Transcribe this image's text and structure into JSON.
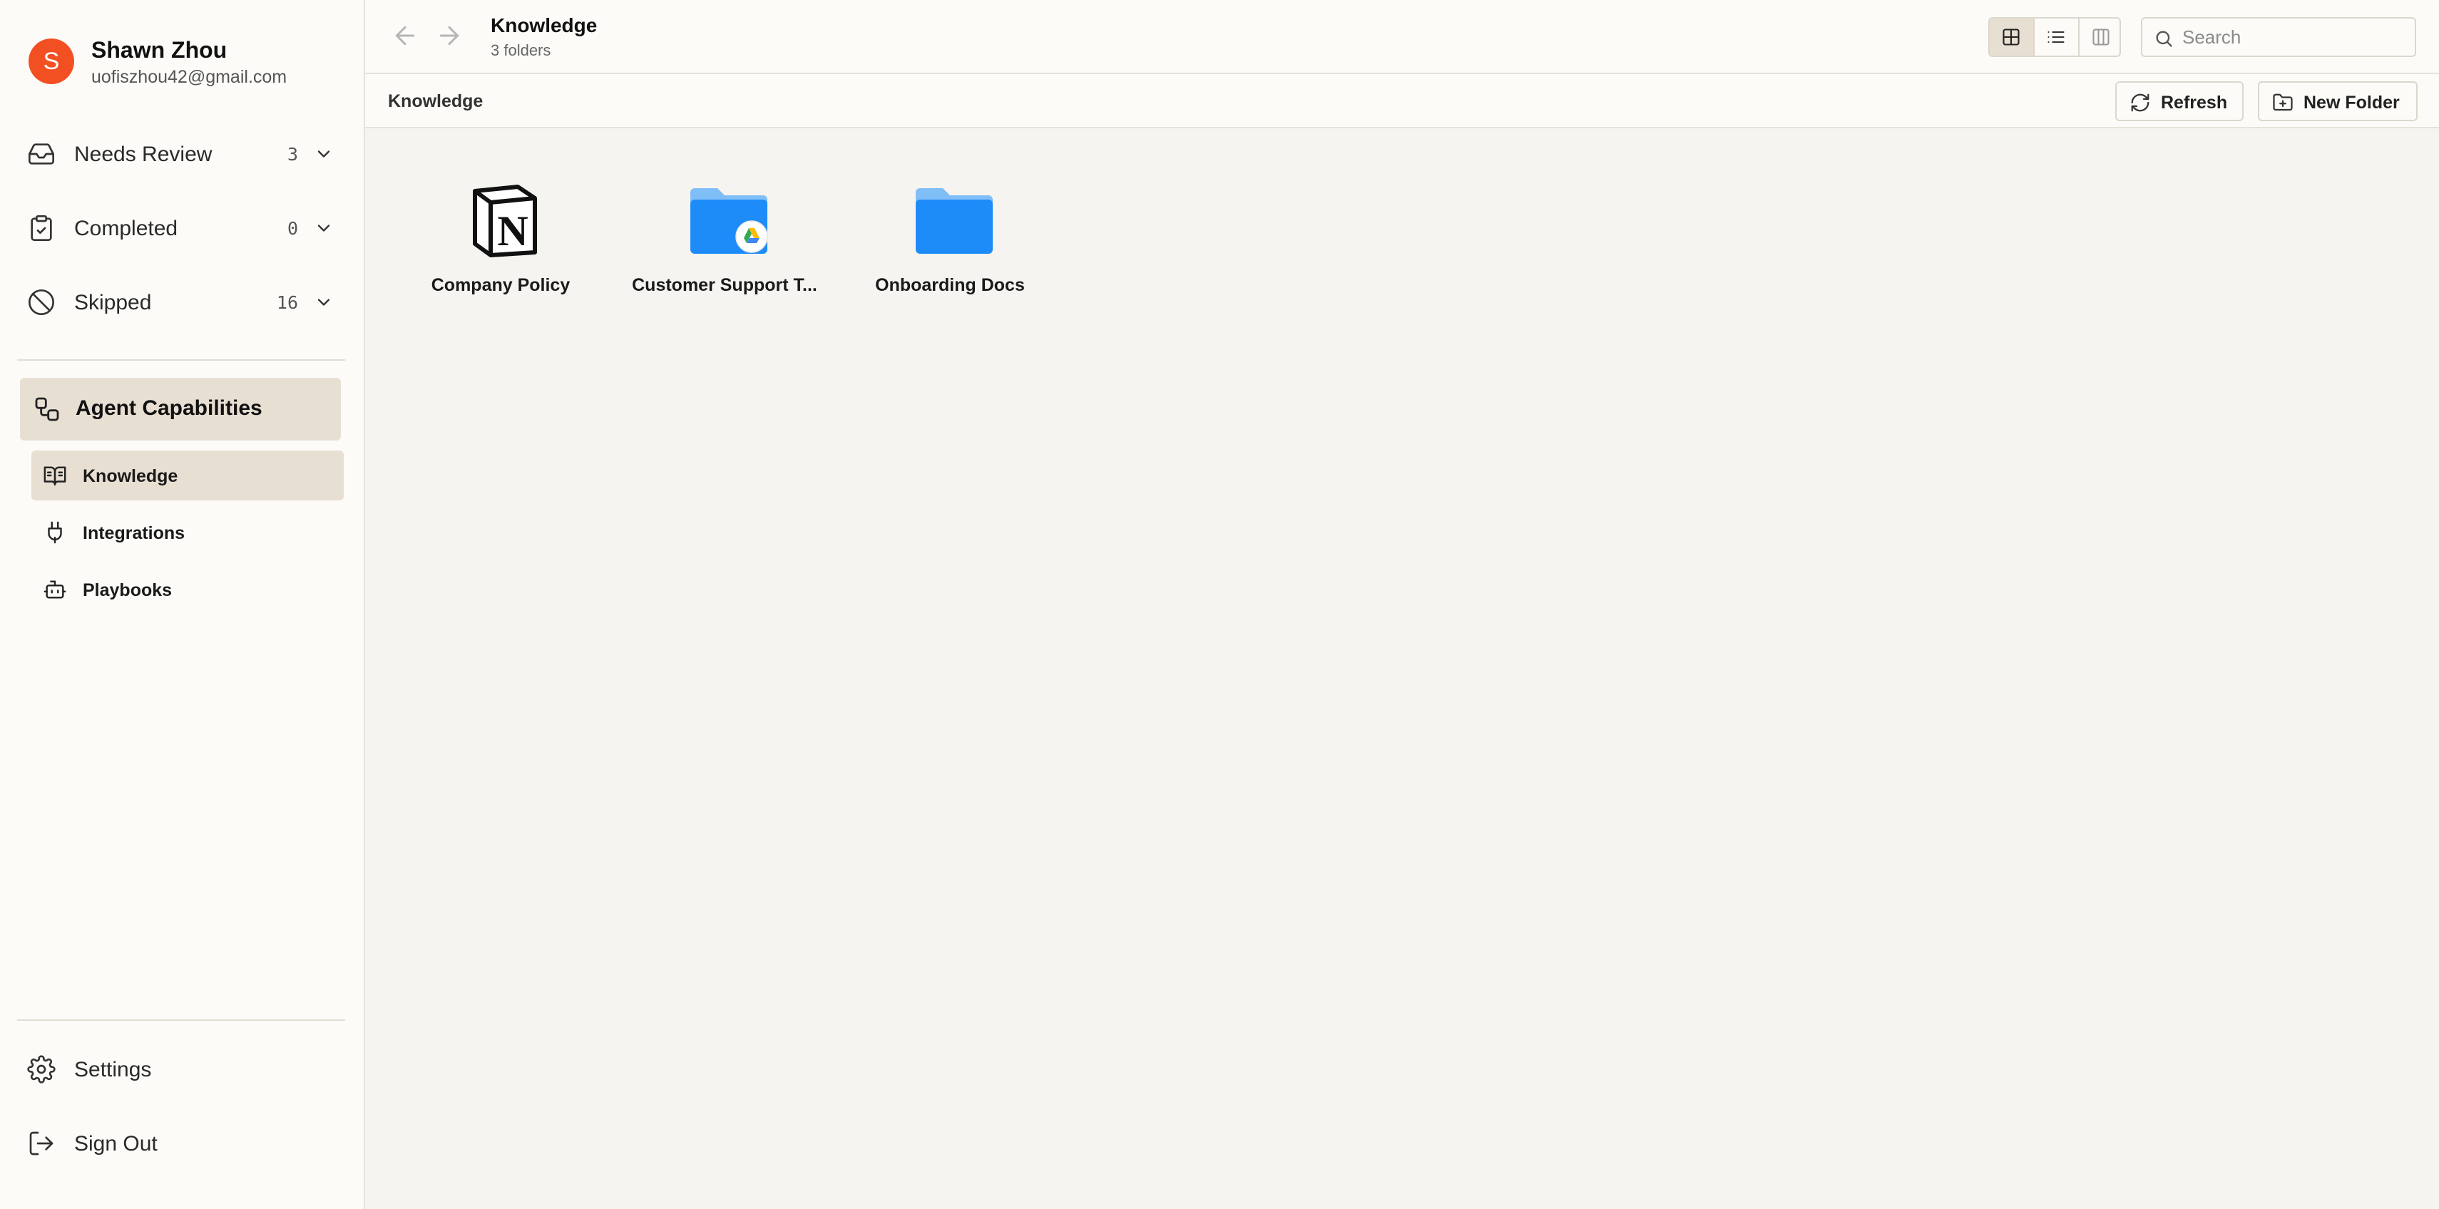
{
  "user": {
    "initial": "S",
    "name": "Shawn Zhou",
    "email": "uofiszhou42@gmail.com",
    "avatar_color": "#f25022"
  },
  "nav": {
    "needs_review": {
      "label": "Needs Review",
      "count": "3",
      "icon": "inbox-icon"
    },
    "completed": {
      "label": "Completed",
      "count": "0",
      "icon": "clipboard-check-icon"
    },
    "skipped": {
      "label": "Skipped",
      "count": "16",
      "icon": "ban-icon"
    }
  },
  "capabilities": {
    "label": "Agent Capabilities",
    "icon": "workflow-icon",
    "items": [
      {
        "label": "Knowledge",
        "icon": "book-open-icon",
        "active": true
      },
      {
        "label": "Integrations",
        "icon": "plug-icon",
        "active": false
      },
      {
        "label": "Playbooks",
        "icon": "bot-icon",
        "active": false
      }
    ]
  },
  "footer": {
    "settings": "Settings",
    "sign_out": "Sign Out"
  },
  "header": {
    "title": "Knowledge",
    "subtitle": "3 folders",
    "search_placeholder": "Search",
    "view_modes": [
      "grid",
      "list",
      "columns"
    ],
    "active_view": "grid"
  },
  "toolbar": {
    "breadcrumb": "Knowledge",
    "refresh": "Refresh",
    "new_folder": "New Folder"
  },
  "folders": [
    {
      "name": "Company Policy",
      "icon": "notion-icon"
    },
    {
      "name": "Customer Support T...",
      "icon": "google-drive-folder-icon"
    },
    {
      "name": "Onboarding Docs",
      "icon": "folder-icon"
    }
  ],
  "colors": {
    "accent_bg": "#e8dfd3",
    "folder_blue": "#1d8bf8",
    "folder_tab": "#7fbef7"
  }
}
